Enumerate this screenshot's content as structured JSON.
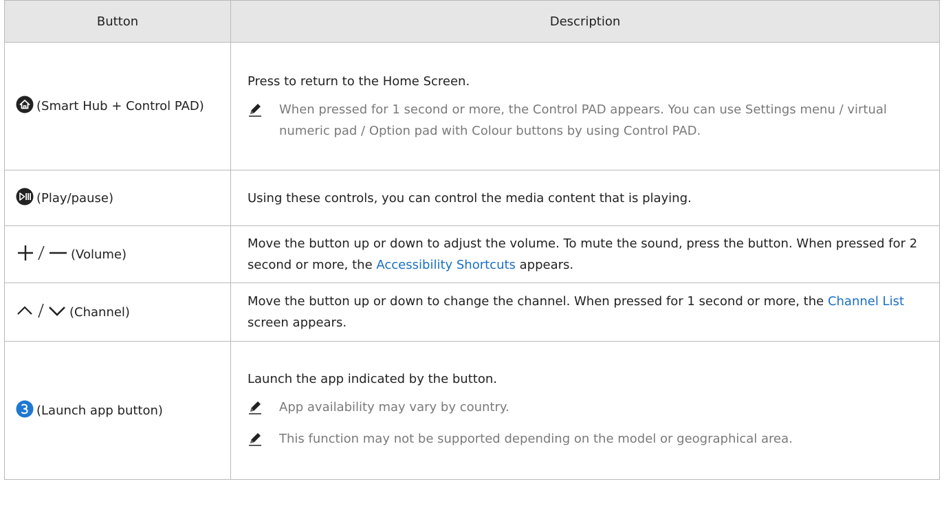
{
  "table": {
    "header": {
      "button": "Button",
      "description": "Description"
    },
    "rows": {
      "home": {
        "button": "(Smart Hub + Control PAD)",
        "icon": "home-circle-icon",
        "desc": "Press to return to the Home Screen.",
        "note": "When pressed for 1 second or more, the Control PAD appears. You can use Settings menu / virtual numeric pad / Option pad with Colour buttons by using Control PAD."
      },
      "play": {
        "button": "(Play/pause)",
        "icon": "play-pause-icon",
        "desc": "Using these controls, you can control the media content that is playing."
      },
      "volume": {
        "button": "(Volume)",
        "icon": "plus-minus-icon",
        "desc_before": "Move the button up or down to adjust the volume. To mute the sound, press the button. When pressed for 2 second or more, the ",
        "desc_link": "Accessibility Shortcuts",
        "desc_after": " appears."
      },
      "channel": {
        "button": "(Channel)",
        "icon": "up-down-chevron-icon",
        "desc_before": "Move the button up or down to change the channel. When pressed for 1 second or more, the ",
        "desc_link": "Channel List",
        "desc_after": " screen appears."
      },
      "app": {
        "button": "(Launch app button)",
        "icon": "number-3-circle-icon",
        "desc": "Launch the app indicated by the button.",
        "note1": "App availability may vary by country.",
        "note2": "This function may not be supported depending on the model or geographical area."
      }
    }
  },
  "colors": {
    "header_bg": "#e6e6e6",
    "border": "#b9b9b9",
    "link": "#1a6fc4",
    "note": "#7a7a7a",
    "icon_dark": "#222222",
    "icon_blue": "#1f78d1"
  }
}
